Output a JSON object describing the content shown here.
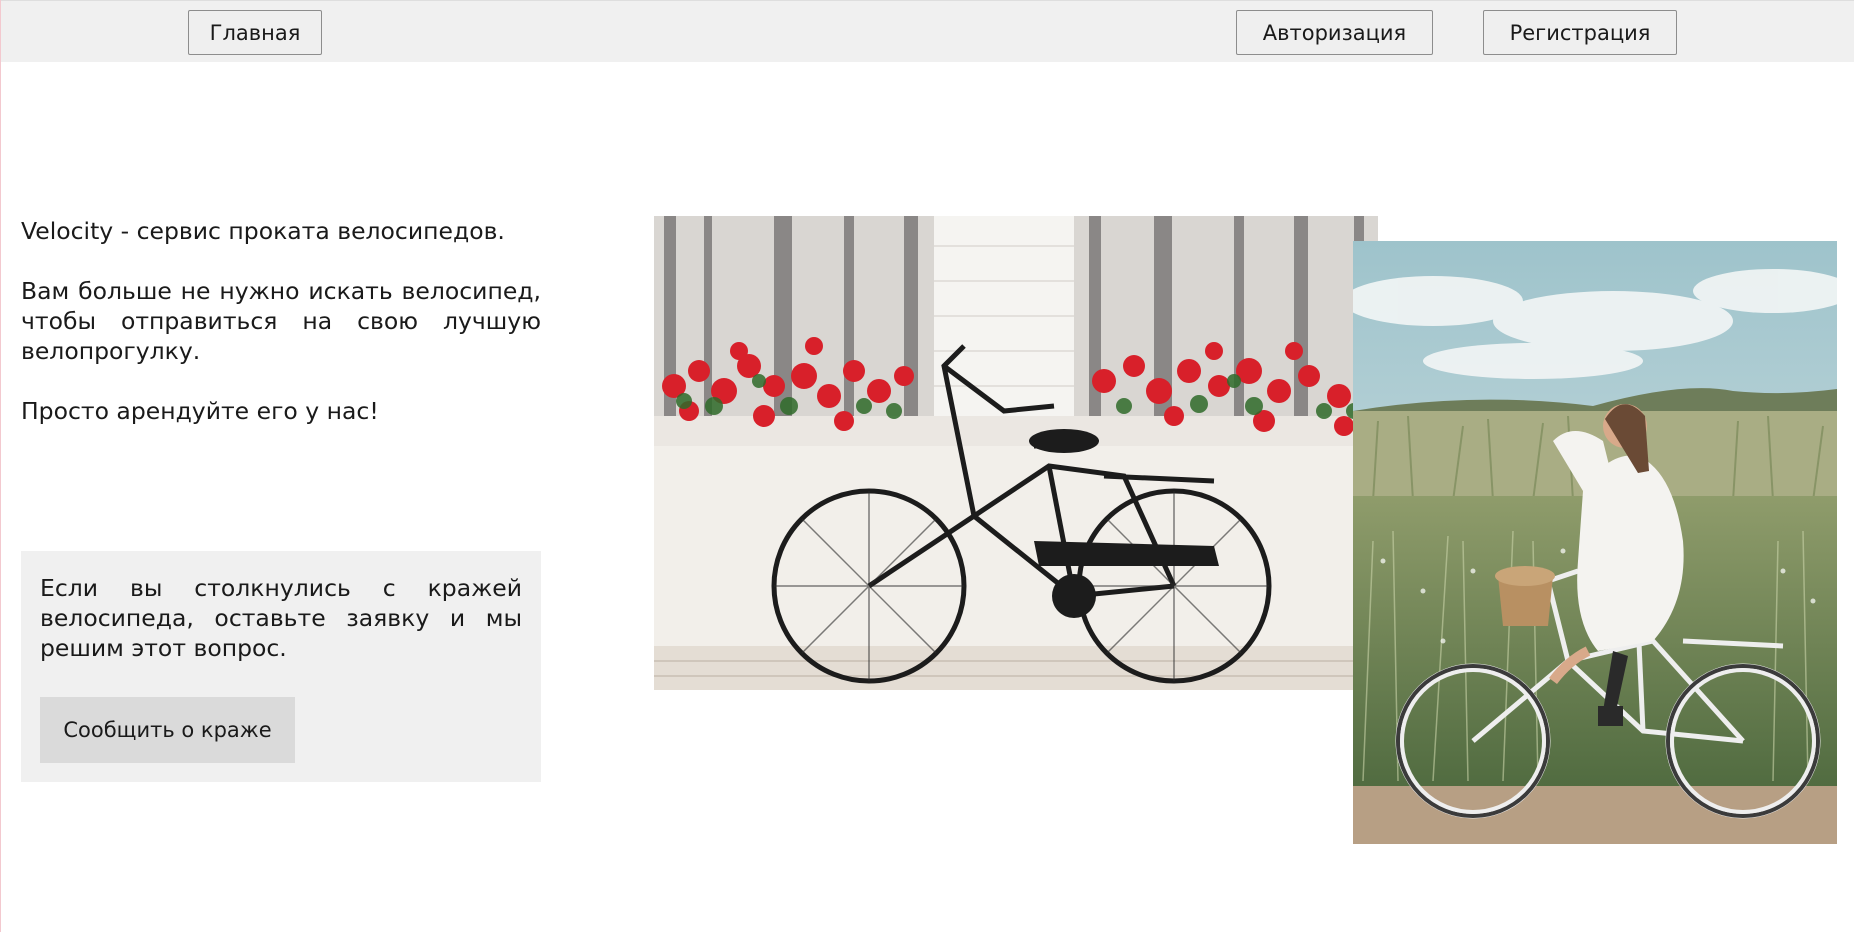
{
  "nav": {
    "home_label": "Главная",
    "login_label": "Авторизация",
    "register_label": "Регистрация"
  },
  "intro": {
    "line1": "Velocity - сервис проката велосипедов.",
    "line2": "Вам больше не нужно искать велосипед, чтобы отправиться на свою лучшую велопрогулку.",
    "line3": "Просто арендуйте его у нас!"
  },
  "theft": {
    "text": "Если вы столкнулись с кражей велосипеда, оставьте заявку и мы решим этот вопрос.",
    "button_label": "Сообщить о краже"
  },
  "colors": {
    "nav_bg": "#f0f0f0",
    "box_bg": "#f0f0f0",
    "button_bg": "#dadada"
  }
}
